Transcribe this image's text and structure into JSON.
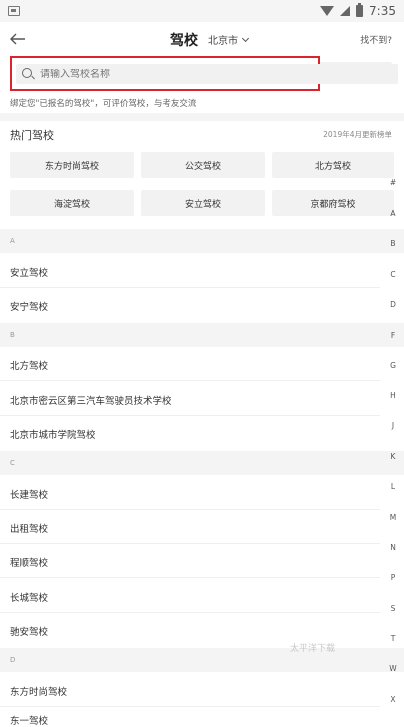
{
  "status": {
    "time": "7:35"
  },
  "header": {
    "title": "驾校",
    "city": "北京市",
    "not_found": "找不到?"
  },
  "search": {
    "placeholder": "请输入驾校名称"
  },
  "hint": "绑定您\"已报名的驾校\"，可评价驾校，与考友交流",
  "hot": {
    "title": "热门驾校",
    "update_note": "2019年4月更新榜单",
    "chips": [
      "东方时尚驾校",
      "公交驾校",
      "北方驾校",
      "海淀驾校",
      "安立驾校",
      "京都府驾校"
    ]
  },
  "sections": [
    {
      "letter": "A",
      "items": [
        "安立驾校",
        "安宁驾校"
      ]
    },
    {
      "letter": "B",
      "items": [
        "北方驾校",
        "北京市密云区第三汽车驾驶员技术学校",
        "北京市城市学院驾校"
      ]
    },
    {
      "letter": "C",
      "items": [
        "长建驾校",
        "出租驾校",
        "程顺驾校",
        "长城驾校",
        "驰安驾校"
      ]
    },
    {
      "letter": "D",
      "items": [
        "东方时尚驾校",
        "东一驾校"
      ]
    }
  ],
  "index_bar": [
    "#",
    "A",
    "B",
    "C",
    "D",
    "F",
    "G",
    "H",
    "J",
    "K",
    "L",
    "M",
    "N",
    "P",
    "S",
    "T",
    "W",
    "X"
  ],
  "watermark": "太平洋下载"
}
